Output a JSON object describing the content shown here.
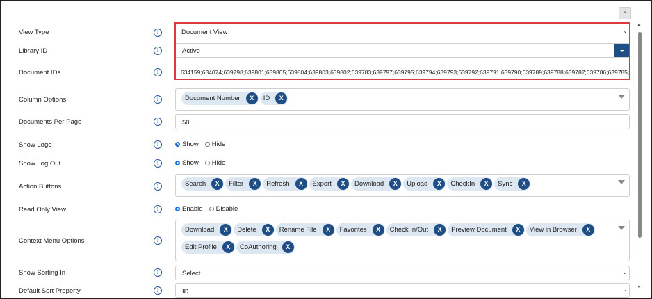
{
  "close": {
    "glyph": "×"
  },
  "info_glyph": "i",
  "fields": {
    "view_type": {
      "label": "View Type",
      "value": "Document View"
    },
    "library_id": {
      "label": "Library ID",
      "value": "Active"
    },
    "document_ids": {
      "label": "Document IDs",
      "value": "634159;634074;639798;639801;639805;639804;639803;639802;639783;639797;639795;639794;639793;639792;639791;639790;639789;639788;639787;639786;639785;6"
    },
    "column_options": {
      "label": "Column Options",
      "chips": [
        "Document Number",
        "ID"
      ]
    },
    "documents_per_page": {
      "label": "Documents Per Page",
      "value": "50"
    },
    "show_logo": {
      "label": "Show Logo",
      "options": [
        "Show",
        "Hide"
      ],
      "selected": "Show"
    },
    "show_log_out": {
      "label": "Show Log Out",
      "options": [
        "Show",
        "Hide"
      ],
      "selected": "Show"
    },
    "action_buttons": {
      "label": "Action Buttons",
      "chips": [
        "Search",
        "Filter",
        "Refresh",
        "Export",
        "Download",
        "Upload",
        "CheckIn",
        "Sync"
      ]
    },
    "read_only_view": {
      "label": "Read Only View",
      "options": [
        "Enable",
        "Disable"
      ],
      "selected": "Enable"
    },
    "context_menu_options": {
      "label": "Context Menu Options",
      "chips": [
        "Download",
        "Delete",
        "Rename File",
        "Favorites",
        "Check In/Out",
        "Preview Document",
        "View in Browser",
        "Edit Profile",
        "CoAuthoring"
      ]
    },
    "show_sorting_in": {
      "label": "Show Sorting In",
      "value": "Select"
    },
    "default_sort_property": {
      "label": "Default Sort Property",
      "value": "ID"
    }
  },
  "chip_remove_glyph": "X",
  "chevron_glyph": "⌄",
  "colors": {
    "accent": "#1f4e87",
    "highlight_border": "#d93a3f",
    "chip_bg": "#dde7f2"
  }
}
